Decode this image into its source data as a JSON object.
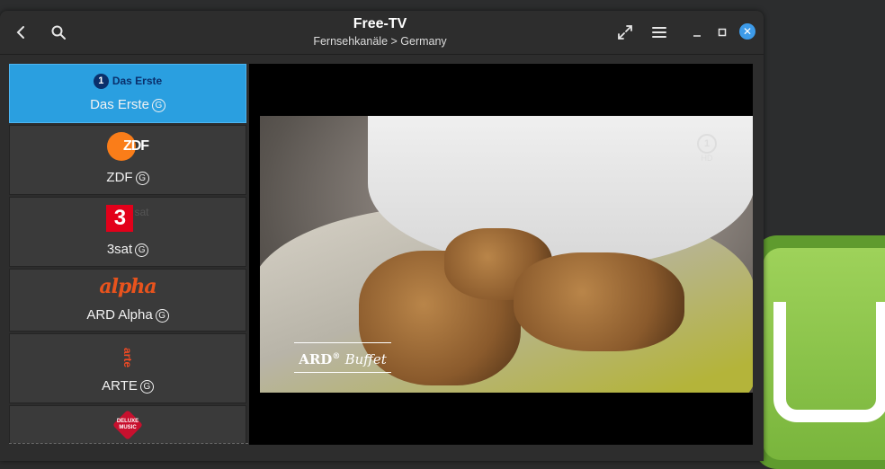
{
  "window": {
    "title": "Free-TV",
    "subtitle": "Fernsehkanäle > Germany"
  },
  "header": {
    "back_icon": "chevron-left-icon",
    "search_icon": "search-icon",
    "expand_icon": "expand-icon",
    "menu_icon": "hamburger-menu-icon",
    "minimize_icon": "minimize-icon",
    "maximize_icon": "maximize-icon",
    "close_icon": "close-icon"
  },
  "channels": [
    {
      "name": "Das Erste",
      "logo_text": "Das Erste",
      "logo_mark": "1",
      "badge": "G",
      "selected": true
    },
    {
      "name": "ZDF",
      "logo_text": "ZDF",
      "badge": "G",
      "selected": false
    },
    {
      "name": "3sat",
      "logo_text": "3",
      "logo_suffix": "sat",
      "badge": "G",
      "selected": false
    },
    {
      "name": "ARD Alpha",
      "logo_text": "alpha",
      "badge": "G",
      "selected": false
    },
    {
      "name": "ARTE",
      "logo_text": "arte",
      "badge": "G",
      "selected": false
    },
    {
      "name": "",
      "logo_text": "DELUXE MUSIC",
      "badge": "",
      "selected": false
    }
  ],
  "video": {
    "station_bug": "1",
    "station_bug_hd": "HD",
    "show_bug": "ARD",
    "show_bug_reg": "®",
    "show_bug_script": "Buffet"
  },
  "colors": {
    "accent": "#2a9fe0",
    "zdf_orange": "#fa7d19",
    "three_sat_red": "#e2001a",
    "alpha_orange": "#e8531d",
    "arte_orange": "#f04a24"
  }
}
